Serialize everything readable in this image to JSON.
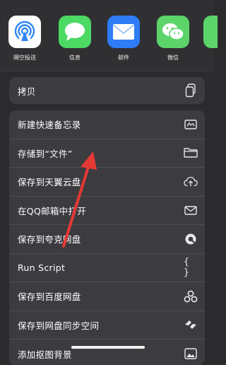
{
  "apps": [
    {
      "label": "隔空投送",
      "icon": "airdrop-icon",
      "color": "#ffffff"
    },
    {
      "label": "信息",
      "icon": "messages-icon",
      "color": "#4cd964"
    },
    {
      "label": "邮件",
      "icon": "mail-icon",
      "color": "#2e7cf6"
    },
    {
      "label": "微信",
      "icon": "wechat-icon",
      "color": "#5cd46a"
    }
  ],
  "copy_action": {
    "label": "拷贝",
    "icon": "copy-icon"
  },
  "actions": [
    {
      "label": "新建快速备忘录",
      "icon": "quick-note-icon"
    },
    {
      "label": "存储到“文件”",
      "icon": "folder-icon"
    },
    {
      "label": "保存到天翼云盘",
      "icon": "cloud-upload-icon"
    },
    {
      "label": "在QQ邮箱中打开",
      "icon": "envelope-icon"
    },
    {
      "label": "保存到夸克网盘",
      "icon": "quark-icon"
    },
    {
      "label": "Run Script",
      "icon": "braces-icon"
    },
    {
      "label": "保存到百度网盘",
      "icon": "baidu-netdisk-icon"
    },
    {
      "label": "保存到网盘同步空间",
      "icon": "sync-space-icon"
    },
    {
      "label": "添加抠图背景",
      "icon": "image-icon"
    }
  ],
  "annotation": {
    "arrow_color": "#e53935"
  }
}
